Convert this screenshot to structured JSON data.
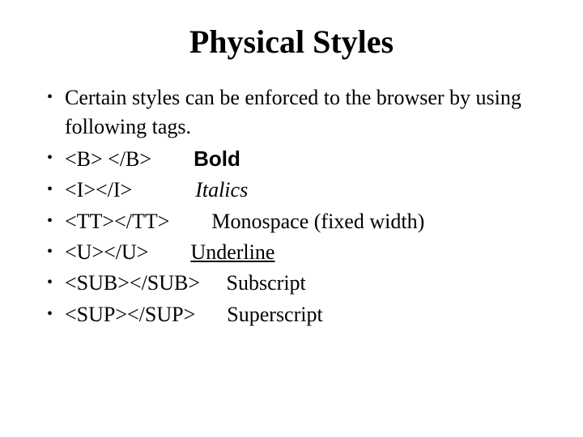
{
  "title": "Physical Styles",
  "bullets": {
    "intro": "Certain styles can be enforced to the browser by using following tags.",
    "b_tag": "<B> </B>        ",
    "b_label": "Bold",
    "i_tag": "<I></I>            ",
    "i_label": "Italics",
    "tt_tag": "<TT></TT>        ",
    "tt_label": "Monospace (fixed width)",
    "u_tag": "<U></U>        ",
    "u_label": "Underline",
    "sub_tag": "<SUB></SUB>     ",
    "sub_label": "Subscript",
    "sup_tag": "<SUP></SUP>      ",
    "sup_label": "Superscript"
  }
}
